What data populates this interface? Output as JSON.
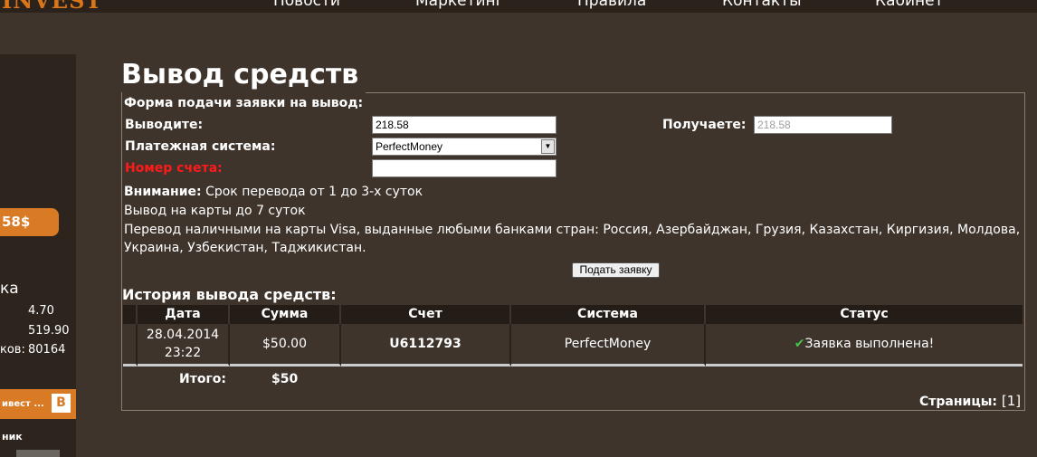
{
  "header": {
    "logo": "INVEST",
    "nav": [
      "Новости",
      "Маркетинг",
      "Правила",
      "Контакты",
      "Кабинет"
    ]
  },
  "sidebar": {
    "balance": "58$",
    "stats_title": "ка",
    "stats": [
      {
        "label": "",
        "value": "4.70"
      },
      {
        "label": "",
        "value": "519.90"
      },
      {
        "label": "ков:",
        "value": "80164"
      }
    ],
    "vk_banner": "ивест ...",
    "vk_logo": "B",
    "bottom_text": "ник"
  },
  "page": {
    "title": "Вывод средств",
    "form_legend": "Форма подачи заявки на вывод:",
    "labels": {
      "amount": "Выводите:",
      "receive": "Получаете:",
      "system": "Платежная система:",
      "account": "Номер счета:"
    },
    "amount_value": "218.58",
    "receive_value": "218.58",
    "system_value": "PerfectMoney",
    "account_value": "",
    "notice_bold": "Внимание:",
    "notice_1": " Срок перевода от 1 до 3-х суток",
    "notice_2": "Вывод на карты до 7 суток",
    "notice_3": "Перевод наличными на карты Visa, выданные любыми банками стран: Россия, Азербайджан, Грузия, Казахстан, Киргизия, Молдова,",
    "notice_4": "Украина, Узбекистан, Таджикистан.",
    "submit_label": "Подать заявку",
    "history_title": "История вывода средств:",
    "table": {
      "headers": [
        "",
        "Дата",
        "Сумма",
        "Счет",
        "Система",
        "Статус"
      ],
      "rows": [
        {
          "date": "28.04.2014",
          "time": "23:22",
          "sum": "$50.00",
          "account": "U6112793",
          "system": "PerfectMoney",
          "status": "Заявка выполнена!"
        }
      ]
    },
    "total_label": "Итого:",
    "total_value": "$50",
    "pages_label": "Страницы:",
    "pages_value": "[1]"
  },
  "colors": {
    "accent": "#d97a24",
    "background": "#3e342c",
    "table_header": "#241c16",
    "error_label": "#ff1a1a",
    "status_ok": "#46c24a"
  }
}
